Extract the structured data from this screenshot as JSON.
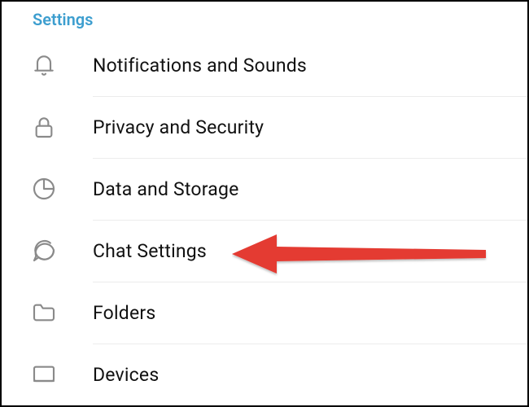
{
  "header": {
    "title": "Settings"
  },
  "items": [
    {
      "label": "Notifications and Sounds",
      "icon": "bell"
    },
    {
      "label": "Privacy and Security",
      "icon": "lock"
    },
    {
      "label": "Data and Storage",
      "icon": "pie"
    },
    {
      "label": "Chat Settings",
      "icon": "chat"
    },
    {
      "label": "Folders",
      "icon": "folder"
    },
    {
      "label": "Devices",
      "icon": "device"
    }
  ],
  "annotation": {
    "target_index": 3
  }
}
